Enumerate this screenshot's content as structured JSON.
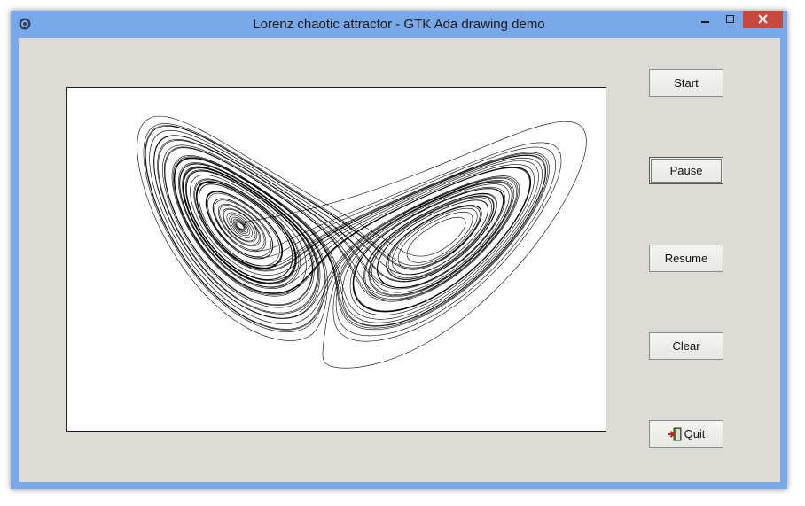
{
  "window": {
    "title": "Lorenz chaotic attractor - GTK Ada drawing demo",
    "controls": {
      "minimize": "minimize-icon",
      "maximize": "maximize-icon",
      "close": "close-icon"
    }
  },
  "buttons": {
    "start": "Start",
    "pause": "Pause",
    "resume": "Resume",
    "clear": "Clear",
    "quit": "Quit"
  },
  "icons": {
    "app": "gear-icon",
    "quit": "exit-door-icon"
  },
  "colors": {
    "titlebar": "#78a8e8",
    "close": "#c7483f",
    "client": "#dcdbd6",
    "trace": "#000000"
  }
}
